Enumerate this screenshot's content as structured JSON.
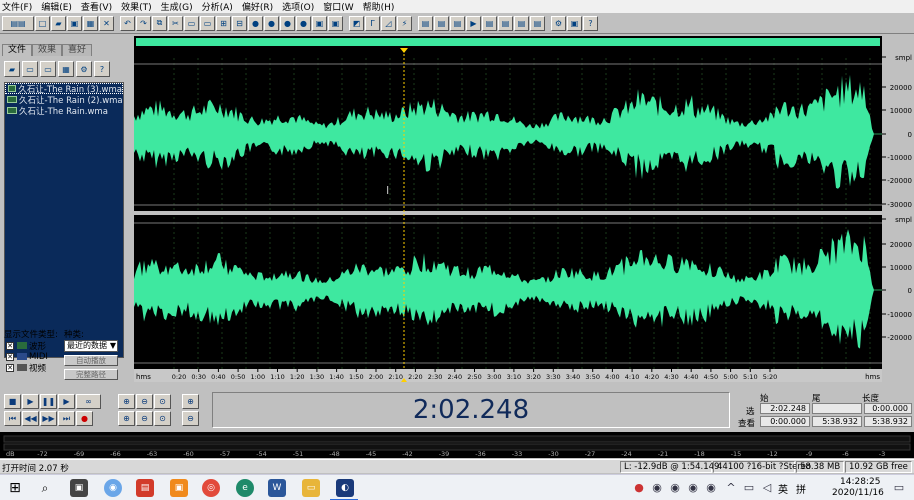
{
  "menu": [
    "文件(F)",
    "编辑(E)",
    "查看(V)",
    "效果(T)",
    "生成(G)",
    "分析(A)",
    "偏好(R)",
    "选项(O)",
    "窗口(W",
    "帮助(H)"
  ],
  "left_panel": {
    "tabs": [
      "文件",
      "效果",
      "喜好"
    ],
    "files": [
      "久石让-The Rain (3).wma",
      "久石让-The Rain (2).wma",
      "久石让-The Rain.wma"
    ],
    "show_label": "显示文件类型:",
    "kind_label": "种类:",
    "types": [
      "波形",
      "MIDI",
      "视频"
    ],
    "kind_value": "最近的数据",
    "btn_autoplay": "自动播放",
    "btn_fullpath": "完整路径"
  },
  "scale": {
    "unit": "smpl",
    "ch1": [
      "20000",
      "10000",
      "0",
      "-10000",
      "-20000",
      "-30000"
    ],
    "ch2": [
      "20000",
      "10000",
      "0",
      "-10000",
      "-20000"
    ]
  },
  "timeline": {
    "unit": "hms",
    "ticks": [
      "0:20",
      "0:30",
      "0:40",
      "0:50",
      "1:00",
      "1:10",
      "1:20",
      "1:30",
      "1:40",
      "1:50",
      "2:00",
      "2:10",
      "2:20",
      "2:30",
      "2:40",
      "2:50",
      "3:00",
      "3:10",
      "3:20",
      "3:30",
      "3:40",
      "3:50",
      "4:00",
      "4:10",
      "4:20",
      "4:30",
      "4:40",
      "4:50",
      "5:00",
      "5:10",
      "5:20"
    ]
  },
  "transport": {
    "time": "2:02.248",
    "headers": [
      "始",
      "尾",
      "长度"
    ],
    "row_labels": [
      "选",
      "查看"
    ],
    "sel": [
      "2:02.248",
      "",
      "0:00.000"
    ],
    "view": [
      "0:00.000",
      "5:38.932",
      "5:38.932"
    ]
  },
  "level": {
    "ticks": [
      "dB",
      "-72",
      "-69",
      "-66",
      "-63",
      "-60",
      "-57",
      "-54",
      "-51",
      "-48",
      "-45",
      "-42",
      "-39",
      "-36",
      "-33",
      "-30",
      "-27",
      "-24",
      "-21",
      "-18",
      "-15",
      "-12",
      "-9",
      "-6",
      "-3",
      "0"
    ]
  },
  "status": {
    "open_time": "打开时间 2.07 秒",
    "cursor": "L: -12.9dB @   1:54.149",
    "format": "44100 ?16-bit ?Stereo",
    "size": "58.38 MB",
    "free": "10.92 GB free"
  },
  "taskbar": {
    "clock_time": "14:28:25",
    "clock_date": "2020/11/16",
    "ime": "英",
    "ime2": "拼"
  },
  "colors": {
    "wave": "#3ee8a0",
    "bg": "#000000",
    "grid": "#1a3a1a",
    "center": "#2a9a5a",
    "cursor": "#ffd000"
  }
}
